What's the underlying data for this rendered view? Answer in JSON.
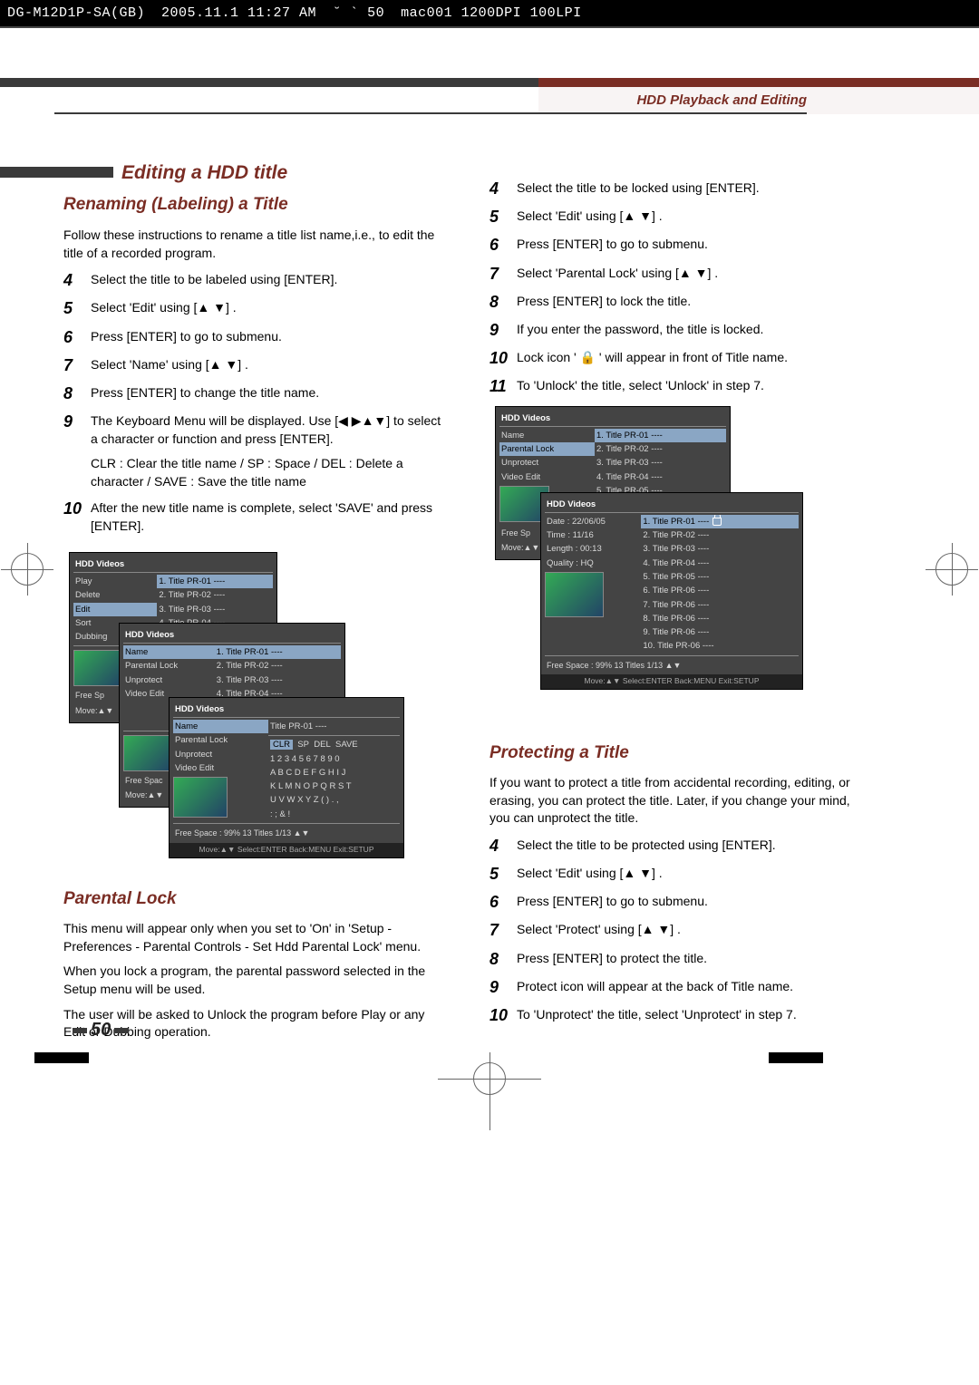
{
  "print_header": {
    "file": "DG-M12D1P-SA(GB)",
    "date": "2005.11.1 11:27 AM",
    "pg": "˘   `  50",
    "extra": "mac001  1200DPI 100LPI"
  },
  "section_label": "HDD Playback and Editing",
  "main_heading": "Editing a HDD title",
  "renaming": {
    "heading": "Renaming (Labeling) a Title",
    "intro": "Follow these instructions to rename a title list name,i.e., to edit the title of a recorded program.",
    "steps": {
      "4": "Select the title to be labeled using [ENTER].",
      "5": "Select 'Edit' using [▲ ▼] .",
      "6": "Press [ENTER] to go to submenu.",
      "7": "Select 'Name' using [▲ ▼] .",
      "8": "Press [ENTER] to change the title name.",
      "9": "The Keyboard Menu will be displayed. Use [◀ ▶▲▼] to select a character or function and press [ENTER].",
      "9_sub": "CLR : Clear the title name /  SP : Space /  DEL : Delete a character /  SAVE : Save the title name",
      "10": "After the new title name is complete, select 'SAVE' and press [ENTER]."
    }
  },
  "parental": {
    "heading": "Parental Lock",
    "p1": "This menu will appear only when you set to 'On' in 'Setup - Preferences - Parental Controls - Set Hdd Parental Lock' menu.",
    "p2": "When you lock a program, the parental password selected in the Setup menu will be used.",
    "p3": "The user will be asked to Unlock the program before Play or any Edit or Dubbing operation.",
    "steps": {
      "4": "Select the title to be locked using [ENTER].",
      "5": "Select 'Edit' using [▲ ▼] .",
      "6": "Press [ENTER] to go to submenu.",
      "7": "Select 'Parental Lock' using [▲ ▼] .",
      "8": "Press [ENTER] to lock the title.",
      "9": "If you enter the password, the title is locked.",
      "10": "Lock icon ' 🔒 ' will appear in front of Title name.",
      "11": "To 'Unlock' the title, select 'Unlock' in step 7."
    }
  },
  "protecting": {
    "heading": "Protecting a Title",
    "intro": "If you want to protect a title from accidental recording, editing, or erasing, you can protect the title. Later, if you change your mind, you can unprotect the title.",
    "steps": {
      "4": "Select the title to be protected using [ENTER].",
      "5": "Select 'Edit' using [▲ ▼] .",
      "6": "Press [ENTER] to go to submenu.",
      "7": "Select 'Protect' using [▲ ▼] .",
      "8": "Press [ENTER] to protect the title.",
      "9": "Protect icon will appear at the back of Title name.",
      "10": "To 'Unprotect' the title, select 'Unprotect' in step 7."
    }
  },
  "osd": {
    "title": "HDD Videos",
    "menus_a": [
      "Play",
      "Delete",
      "Edit",
      "Sort",
      "Dubbing"
    ],
    "menus_b": [
      "Name",
      "Parental Lock",
      "Unprotect",
      "Video Edit"
    ],
    "titles_short": [
      "1. Title PR-01 ----",
      "2. Title PR-02 ----",
      "3. Title PR-03 ----",
      "4. Title PR-04 ----",
      "5. Title PR-05 ----",
      "6. Title PR-06 ----"
    ],
    "titles_long": [
      "1. Title PR-01 ----",
      "2. Title PR-02 ----",
      "3. Title PR-03 ----",
      "4. Title PR-04 ----",
      "5. Title PR-05 ----",
      "6. Title PR-06 ----",
      "7. Title PR-06 ----",
      "8. Title PR-06 ----",
      "9. Title PR-06 ----",
      "10. Title PR-06 ----"
    ],
    "info": {
      "date": "Date : 22/06/05",
      "time": "Time : 11/16",
      "length": "Length : 00:13",
      "quality": "Quality : HQ"
    },
    "free_sp": "Free Sp",
    "free_spac": "Free Spac",
    "move": "Move:▲▼",
    "free_full": "Free Space : 99% 13 Titles      1/13  ▲▼",
    "footer": "Move:▲▼  Select:ENTER  Back:MENU  Exit:SETUP",
    "kb": {
      "name_label": "Name",
      "name_val": "Title PR-01 ----",
      "r1": "CLR  SP  DEL  SAVE",
      "r2": "1 2 3 4 5 6 7 8 9 0",
      "r3": "A B C D E F G H I J",
      "r4": "K L M N O P Q R S T",
      "r5": "U V W X Y Z (  )  . ,",
      "r6": ": ; & !"
    }
  },
  "page_num": "50"
}
